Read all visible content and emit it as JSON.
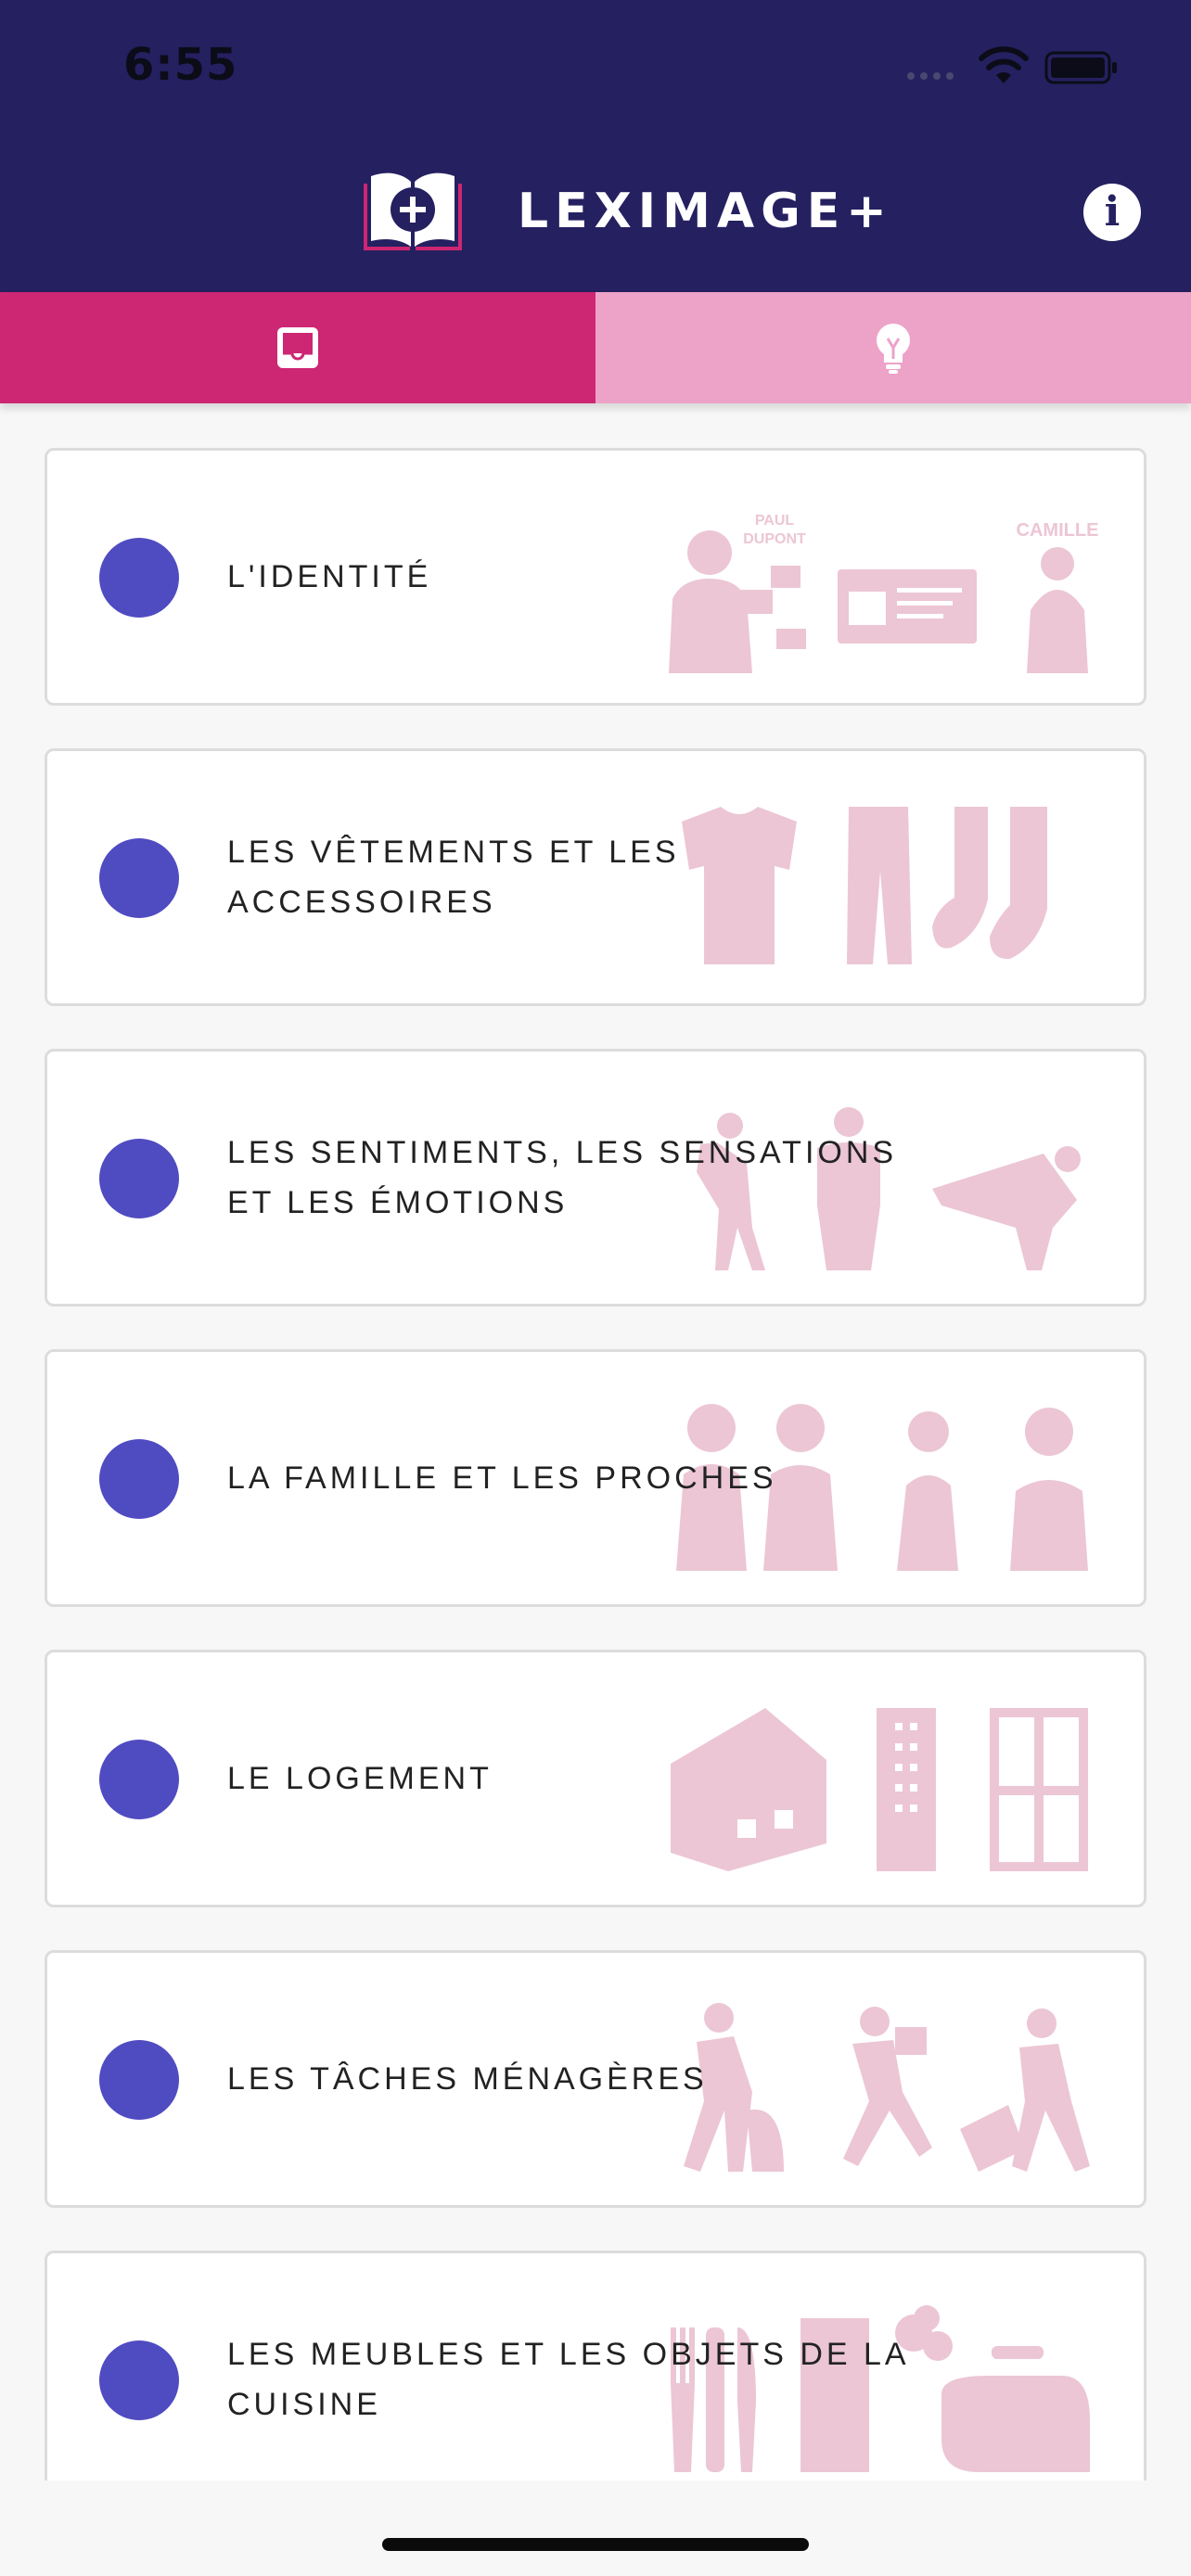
{
  "status_bar": {
    "time": "6:55"
  },
  "header": {
    "title": "LEXIMAGE+",
    "logo_icon": "book-plus-icon",
    "info_icon": "info-icon",
    "info_glyph": "i"
  },
  "tabs": [
    {
      "icon": "inbox-icon",
      "active": true
    },
    {
      "icon": "lightbulb-icon",
      "active": false
    }
  ],
  "colors": {
    "header": "#252060",
    "tab_active": "#cd2673",
    "tab_inactive": "#eda2c8",
    "dot": "#4f4bc1",
    "illustration": "#ecc6d5"
  },
  "categories": [
    {
      "label": "L'IDENTITÉ",
      "illustration": "identity-icon",
      "illustration_texts": [
        "PAUL",
        "DUPONT",
        "CAMILLE"
      ]
    },
    {
      "label": "LES VÊTEMENTS ET LES ACCESSOIRES",
      "illustration": "clothing-icon"
    },
    {
      "label": "LES SENTIMENTS, LES SENSATIONS ET LES ÉMOTIONS",
      "illustration": "emotions-icon"
    },
    {
      "label": "LA FAMILLE ET LES PROCHES",
      "illustration": "family-icon"
    },
    {
      "label": "LE LOGEMENT",
      "illustration": "housing-icon"
    },
    {
      "label": "LES TÂCHES MÉNAGÈRES",
      "illustration": "chores-icon"
    },
    {
      "label": "LES MEUBLES ET LES OBJETS DE LA CUISINE",
      "illustration": "kitchen-icon"
    }
  ]
}
